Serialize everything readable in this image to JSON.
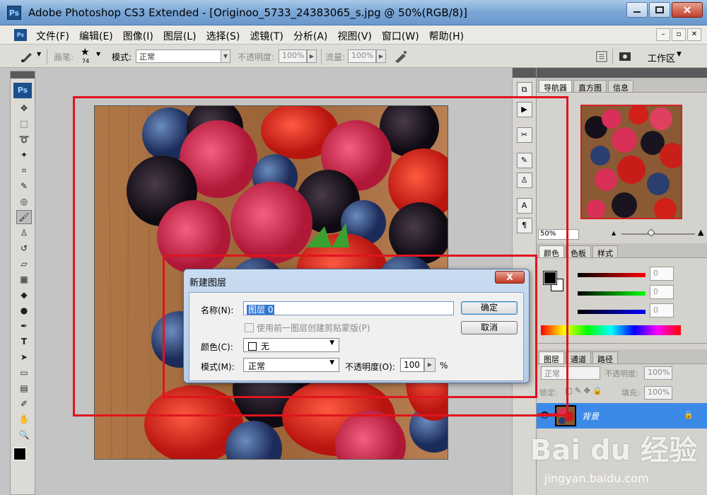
{
  "window": {
    "title": "Adobe Photoshop CS3 Extended - [Originoo_5733_24383065_s.jpg @ 50%(RGB/8)]",
    "app_icon": "Ps"
  },
  "menu": [
    "文件(F)",
    "编辑(E)",
    "图像(I)",
    "图层(L)",
    "选择(S)",
    "滤镜(T)",
    "分析(A)",
    "视图(V)",
    "窗口(W)",
    "帮助(H)"
  ],
  "options": {
    "brush_label": "画笔:",
    "brush_size": "74",
    "mode_label": "模式:",
    "mode_value": "正常",
    "opacity_label": "不透明度:",
    "opacity_value": "100%",
    "flow_label": "流量:",
    "flow_value": "100%",
    "workspace_label": "工作区"
  },
  "toolbox_logo": "Ps",
  "navigator": {
    "tabs": [
      "导航器",
      "直方图",
      "信息"
    ],
    "zoom": "50%"
  },
  "color": {
    "tabs": [
      "颜色",
      "色板",
      "样式"
    ],
    "values": [
      "0",
      "0",
      "0"
    ]
  },
  "layers": {
    "tabs": [
      "图层",
      "通道",
      "路径"
    ],
    "blend_mode": "正常",
    "opacity_label": "不透明度:",
    "opacity": "100%",
    "lock_label": "锁定:",
    "fill_label": "填充:",
    "fill": "100%",
    "layer_name": "背景"
  },
  "dialog": {
    "title": "新建图层",
    "close": "X",
    "name_label": "名称(N):",
    "name_value": "图层 0",
    "clip_label": "使用前一图层创建剪贴蒙版(P)",
    "color_label": "颜色(C):",
    "color_value": "无",
    "mode_label": "模式(M):",
    "mode_value": "正常",
    "opacity_label": "不透明度(O):",
    "opacity_value": "100",
    "percent": "%",
    "ok": "确定",
    "cancel": "取消"
  },
  "watermark": {
    "brand": "Bai du 经验",
    "url": "jingyan.baidu.com"
  }
}
